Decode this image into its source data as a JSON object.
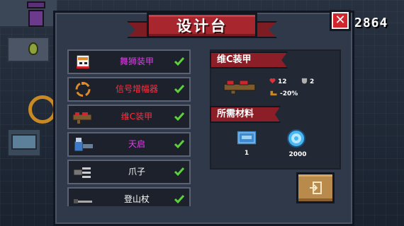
{
  "title": "设计台",
  "score": "2864",
  "close_label": "✕",
  "items": [
    {
      "name": "舞狮装甲",
      "color": "#e040e8",
      "checked": true
    },
    {
      "name": "信号增幅器",
      "color": "#ff3040",
      "checked": true
    },
    {
      "name": "维C装甲",
      "color": "#ff3040",
      "checked": true
    },
    {
      "name": "天启",
      "color": "#e040e8",
      "checked": true
    },
    {
      "name": "爪子",
      "color": "#ffffff",
      "checked": true
    },
    {
      "name": "登山杖",
      "color": "#ffffff",
      "checked": true
    }
  ],
  "detail": {
    "name": "维C装甲",
    "stats": {
      "hp": "12",
      "armor": "2",
      "speed": "-20%"
    },
    "materials_label": "所需材料",
    "materials": [
      {
        "icon": "blueprint-icon",
        "count": "1"
      },
      {
        "icon": "gem-icon",
        "count": "2000"
      }
    ]
  },
  "colors": {
    "accent_red": "#a8262d",
    "check_green": "#5cd13a",
    "panel": "#30394a"
  }
}
